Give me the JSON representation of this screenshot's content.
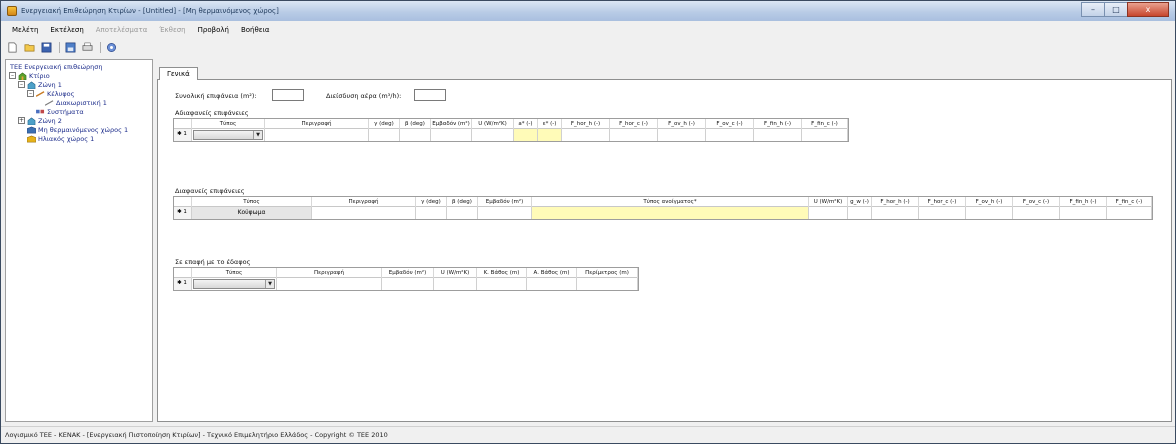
{
  "window": {
    "title": "Ενεργειακή Επιθεώρηση Κτιρίων - [Untitled] - [Μη θερμαινόμενος χώρος]",
    "controls": {
      "minimize": "–",
      "maximize": "□",
      "close": "x"
    }
  },
  "menu": [
    {
      "label": "Μελέτη",
      "enabled": true
    },
    {
      "label": "Εκτέλεση",
      "enabled": true
    },
    {
      "label": "Αποτελέσματα",
      "enabled": false
    },
    {
      "label": "Έκθεση",
      "enabled": false
    },
    {
      "label": "Προβολή",
      "enabled": true
    },
    {
      "label": "Βοήθεια",
      "enabled": true
    }
  ],
  "toolbar": {
    "icons": [
      "new-icon",
      "open-icon",
      "save-icon",
      "save-as-icon",
      "print-icon",
      "settings-icon"
    ]
  },
  "tree": {
    "root": "ΤΕΕ Ενεργειακή επιθεώρηση",
    "building": "Κτίριο",
    "zone1": "Ζώνη 1",
    "envelope": "Κέλυφος",
    "partition": "Διακωριστική 1",
    "systems": "Συστήματα",
    "zone2": "Ζώνη 2",
    "unheated": "Μη θερμαινόμενος χώρος 1",
    "solar": "Ηλιακός χώρος 1"
  },
  "tab": {
    "label": "Γενικά"
  },
  "fields": {
    "total_area_label": "Συνολική επιφάνεια (m²):",
    "total_area_value": "",
    "air_infiltration_label": "Διείσδυση αέρα (m³/h):",
    "air_infiltration_value": ""
  },
  "opaque": {
    "title": "Αδιαφανείς επιφάνειες",
    "columns": [
      "Τύπος",
      "Περιγραφή",
      "γ (deg)",
      "β (deg)",
      "Εμβαδόν (m²)",
      "U (W/m²K)",
      "a* (-)",
      "ε* (-)",
      "F_hor_h (-)",
      "F_hor_c (-)",
      "F_ov_h (-)",
      "F_ov_c (-)",
      "F_fin_h (-)",
      "F_fin_c (-)"
    ],
    "row_marker": "✱",
    "row_number": "1",
    "row_type": ""
  },
  "transparent": {
    "title": "Διαφανείς επιφάνειες",
    "columns": [
      "Τύπος",
      "Περιγραφή",
      "γ (deg)",
      "β (deg)",
      "Εμβαδόν (m²)",
      "Τύπος ανοίγματος*",
      "U (W/m²K)",
      "g_w (-)",
      "F_hor_h (-)",
      "F_hor_c (-)",
      "F_ov_h (-)",
      "F_ov_c (-)",
      "F_fin_h (-)",
      "F_fin_c (-)"
    ],
    "row_marker": "✱",
    "row_number": "1",
    "row_type": "Κούφωμα"
  },
  "ground": {
    "title": "Σε επαφή με το έδαφος",
    "columns": [
      "Τύπος",
      "Περιγραφή",
      "Εμβαδόν (m²)",
      "U (W/m²K)",
      "Κ. Βάθος (m)",
      "Α. Βάθος (m)",
      "Περίμετρος (m)"
    ],
    "row_marker": "✱",
    "row_number": "1",
    "row_type": ""
  },
  "status": {
    "text": "Λογισμικό ΤΕΕ - ΚΕΝΑΚ  -  [Ενεργειακή Πιστοποίηση Κτιρίων]  -  Τεχνικό Επιμελητήριο Ελλάδος  -  Copyright © ΤΕΕ 2010"
  },
  "colors": {
    "required_cell": "#fffbb8",
    "titlebar": "#b9cce6",
    "close_button": "#c7452d"
  }
}
